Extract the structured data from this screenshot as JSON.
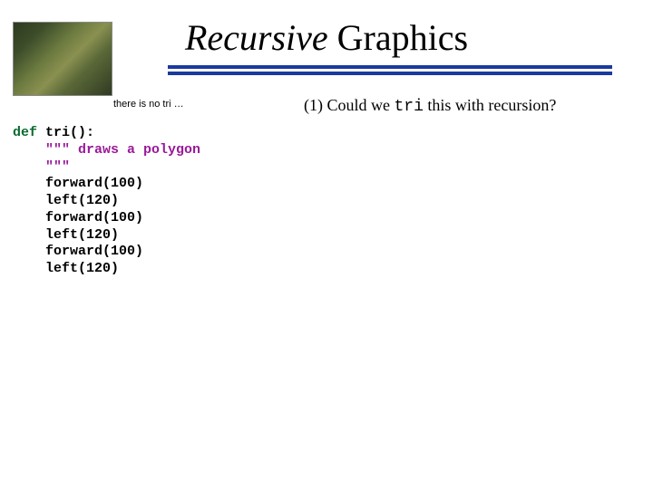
{
  "title": {
    "italic_part": "Recursive",
    "rest": " Graphics"
  },
  "image": {
    "caption": "there is no tri …"
  },
  "question": {
    "num": "(1)",
    "before_mono": " Could we ",
    "mono": "tri",
    "after_mono": " this with recursion?"
  },
  "code": {
    "kw": "def",
    "after_kw": " tri():",
    "indent": "    ",
    "doc_open": "\"\"\" draws a polygon",
    "doc_close": "\"\"\"",
    "line1": "forward(100)",
    "line2": "left(120)",
    "line3": "forward(100)",
    "line4": "left(120)",
    "line5": "forward(100)",
    "line6": "left(120)"
  }
}
